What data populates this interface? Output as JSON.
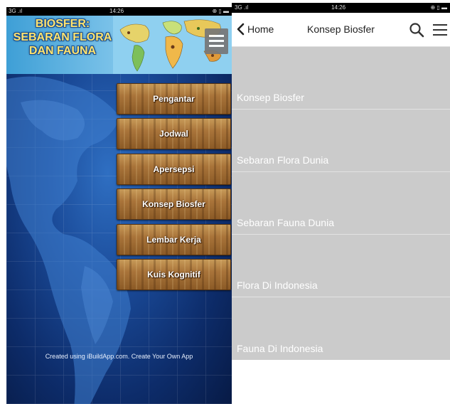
{
  "left_screen": {
    "statusbar": {
      "signal": "3G .ıl",
      "time": "14:26",
      "icons": "⊕ ▯ ▬"
    },
    "banner": {
      "title_line1": "BIOSFER:",
      "title_line2": "SEBARAN FLORA",
      "title_line3": "DAN FAUNA"
    },
    "menu_buttons": [
      {
        "label": "Pengantar"
      },
      {
        "label": "Jodwal"
      },
      {
        "label": "Apersepsi"
      },
      {
        "label": "Konsep Biosfer"
      },
      {
        "label": "Lembar Kerja"
      },
      {
        "label": "Kuis Kognitif"
      }
    ],
    "footer": "Created using iBuildApp.com. Create Your Own App"
  },
  "right_screen": {
    "statusbar": {
      "signal": "3G .ıl",
      "time": "14:26",
      "icons": "⊕ ▯ ▬"
    },
    "navbar": {
      "back_label": "Home",
      "title": "Konsep Biosfer"
    },
    "list_items": [
      {
        "label": "Konsep Biosfer"
      },
      {
        "label": "Sebaran Flora Dunia"
      },
      {
        "label": "Sebaran Fauna Dunia"
      },
      {
        "label": "Flora Di Indonesia"
      },
      {
        "label": "Fauna Di Indonesia"
      }
    ]
  },
  "colors": {
    "left_background": "#0d2b66",
    "banner_title": "#ffe36e",
    "wood_button": "#a9743a",
    "right_list_background": "#cbcbcb",
    "list_text": "#ffffff"
  },
  "icons": [
    "back-chevron-icon",
    "search-icon",
    "hamburger-menu-icon"
  ]
}
